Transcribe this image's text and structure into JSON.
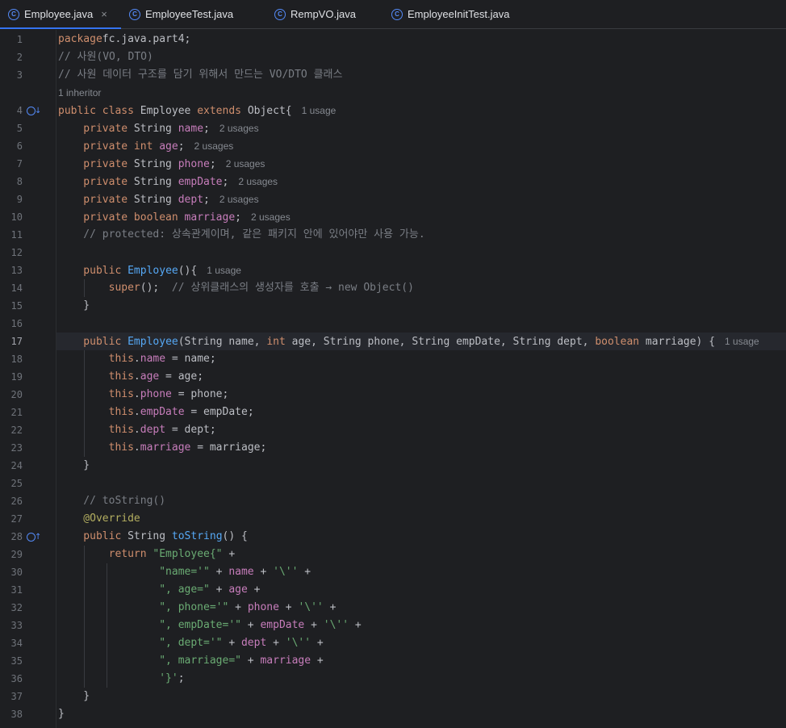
{
  "tabs": [
    {
      "label": "Employee.java",
      "active": true,
      "closable": true
    },
    {
      "label": "EmployeeTest.java",
      "active": false,
      "closable": false
    },
    {
      "label": "RempVO.java",
      "active": false,
      "closable": false
    },
    {
      "label": "EmployeeInitTest.java",
      "active": false,
      "closable": false
    }
  ],
  "tab_close_glyph": "×",
  "inherit_hint": "1 inheritor",
  "current_line": 17,
  "code": {
    "l1": {
      "n": "1",
      "parts": [
        [
          "kw",
          "package"
        ],
        [
          "",
          "fc.java.part4;"
        ]
      ]
    },
    "l2": {
      "n": "2",
      "parts": [
        [
          "cm",
          "// 사원(VO, DTO)"
        ]
      ]
    },
    "l3": {
      "n": "3",
      "parts": [
        [
          "cm",
          "// 사원 데이터 구조를 담기 위해서 만드는 VO/DTO 클래스"
        ]
      ]
    },
    "l4": {
      "n": "4",
      "parts": [
        [
          "kw",
          "public class"
        ],
        [
          "",
          " Employee "
        ],
        [
          "kw",
          "extends"
        ],
        [
          "",
          " Object{"
        ]
      ],
      "hint": "1 usage"
    },
    "l5": {
      "n": "5",
      "parts": [
        [
          "kw",
          "    private"
        ],
        [
          "",
          " String "
        ],
        [
          "fld",
          "name"
        ],
        [
          "",
          ";"
        ]
      ],
      "hint": "2 usages"
    },
    "l6": {
      "n": "6",
      "parts": [
        [
          "kw",
          "    private int"
        ],
        [
          "",
          " "
        ],
        [
          "fld",
          "age"
        ],
        [
          "",
          ";"
        ]
      ],
      "hint": "2 usages"
    },
    "l7": {
      "n": "7",
      "parts": [
        [
          "kw",
          "    private"
        ],
        [
          "",
          " String "
        ],
        [
          "fld",
          "phone"
        ],
        [
          "",
          ";"
        ]
      ],
      "hint": "2 usages"
    },
    "l8": {
      "n": "8",
      "parts": [
        [
          "kw",
          "    private"
        ],
        [
          "",
          " String "
        ],
        [
          "fld",
          "empDate"
        ],
        [
          "",
          ";"
        ]
      ],
      "hint": "2 usages"
    },
    "l9": {
      "n": "9",
      "parts": [
        [
          "kw",
          "    private"
        ],
        [
          "",
          " String "
        ],
        [
          "fld",
          "dept"
        ],
        [
          "",
          ";"
        ]
      ],
      "hint": "2 usages"
    },
    "l10": {
      "n": "10",
      "parts": [
        [
          "kw",
          "    private boolean"
        ],
        [
          "",
          " "
        ],
        [
          "fld",
          "marriage"
        ],
        [
          "",
          ";"
        ]
      ],
      "hint": "2 usages"
    },
    "l11": {
      "n": "11",
      "parts": [
        [
          "cm",
          "    // protected: 상속관계이며, 같은 패키지 안에 있어야만 사용 가능."
        ]
      ]
    },
    "l12": {
      "n": "12",
      "parts": []
    },
    "l13": {
      "n": "13",
      "parts": [
        [
          "kw",
          "    public"
        ],
        [
          "",
          " "
        ],
        [
          "fn",
          "Employee"
        ],
        [
          "",
          "(){"
        ]
      ],
      "hint": "1 usage"
    },
    "l14": {
      "n": "14",
      "parts": [
        [
          "kw",
          "        super"
        ],
        [
          "",
          "();  "
        ],
        [
          "cm",
          "// 상위클래스의 생성자를 호출 → new Object()"
        ]
      ]
    },
    "l15": {
      "n": "15",
      "parts": [
        [
          "",
          "    }"
        ]
      ]
    },
    "l16": {
      "n": "16",
      "parts": []
    },
    "l17": {
      "n": "17",
      "parts": [
        [
          "kw",
          "    public"
        ],
        [
          "",
          " "
        ],
        [
          "fn",
          "Employee"
        ],
        [
          "",
          "(String name, "
        ],
        [
          "kw",
          "int"
        ],
        [
          "",
          " age, String phone, String empDate, String dept, "
        ],
        [
          "kw",
          "boolean"
        ],
        [
          "",
          " marriage) {"
        ]
      ],
      "hint": "1 usage"
    },
    "l18": {
      "n": "18",
      "parts": [
        [
          "kw",
          "        this"
        ],
        [
          "",
          "."
        ],
        [
          "fld",
          "name"
        ],
        [
          "",
          " = name;"
        ]
      ]
    },
    "l19": {
      "n": "19",
      "parts": [
        [
          "kw",
          "        this"
        ],
        [
          "",
          "."
        ],
        [
          "fld",
          "age"
        ],
        [
          "",
          " = age;"
        ]
      ]
    },
    "l20": {
      "n": "20",
      "parts": [
        [
          "kw",
          "        this"
        ],
        [
          "",
          "."
        ],
        [
          "fld",
          "phone"
        ],
        [
          "",
          " = phone;"
        ]
      ]
    },
    "l21": {
      "n": "21",
      "parts": [
        [
          "kw",
          "        this"
        ],
        [
          "",
          "."
        ],
        [
          "fld",
          "empDate"
        ],
        [
          "",
          " = empDate;"
        ]
      ]
    },
    "l22": {
      "n": "22",
      "parts": [
        [
          "kw",
          "        this"
        ],
        [
          "",
          "."
        ],
        [
          "fld",
          "dept"
        ],
        [
          "",
          " = dept;"
        ]
      ]
    },
    "l23": {
      "n": "23",
      "parts": [
        [
          "kw",
          "        this"
        ],
        [
          "",
          "."
        ],
        [
          "fld",
          "marriage"
        ],
        [
          "",
          " = marriage;"
        ]
      ]
    },
    "l24": {
      "n": "24",
      "parts": [
        [
          "",
          "    }"
        ]
      ]
    },
    "l25": {
      "n": "25",
      "parts": []
    },
    "l26": {
      "n": "26",
      "parts": [
        [
          "cm",
          "    // toString()"
        ]
      ]
    },
    "l27": {
      "n": "27",
      "parts": [
        [
          "ann",
          "    @Override"
        ]
      ]
    },
    "l28": {
      "n": "28",
      "parts": [
        [
          "kw",
          "    public"
        ],
        [
          "",
          " String "
        ],
        [
          "fn",
          "toString"
        ],
        [
          "",
          "() {"
        ]
      ]
    },
    "l29": {
      "n": "29",
      "parts": [
        [
          "kw",
          "        return"
        ],
        [
          "",
          " "
        ],
        [
          "str",
          "\"Employee{\""
        ],
        [
          "",
          " +"
        ]
      ]
    },
    "l30": {
      "n": "30",
      "parts": [
        [
          "str",
          "                \"name='\""
        ],
        [
          "",
          " + "
        ],
        [
          "fld",
          "name"
        ],
        [
          "",
          " + "
        ],
        [
          "str",
          "'\\''"
        ],
        [
          "",
          " +"
        ]
      ]
    },
    "l31": {
      "n": "31",
      "parts": [
        [
          "str",
          "                \", age=\""
        ],
        [
          "",
          " + "
        ],
        [
          "fld",
          "age"
        ],
        [
          "",
          " +"
        ]
      ]
    },
    "l32": {
      "n": "32",
      "parts": [
        [
          "str",
          "                \", phone='\""
        ],
        [
          "",
          " + "
        ],
        [
          "fld",
          "phone"
        ],
        [
          "",
          " + "
        ],
        [
          "str",
          "'\\''"
        ],
        [
          "",
          " +"
        ]
      ]
    },
    "l33": {
      "n": "33",
      "parts": [
        [
          "str",
          "                \", empDate='\""
        ],
        [
          "",
          " + "
        ],
        [
          "fld",
          "empDate"
        ],
        [
          "",
          " + "
        ],
        [
          "str",
          "'\\''"
        ],
        [
          "",
          " +"
        ]
      ]
    },
    "l34": {
      "n": "34",
      "parts": [
        [
          "str",
          "                \", dept='\""
        ],
        [
          "",
          " + "
        ],
        [
          "fld",
          "dept"
        ],
        [
          "",
          " + "
        ],
        [
          "str",
          "'\\''"
        ],
        [
          "",
          " +"
        ]
      ]
    },
    "l35": {
      "n": "35",
      "parts": [
        [
          "str",
          "                \", marriage=\""
        ],
        [
          "",
          " + "
        ],
        [
          "fld",
          "marriage"
        ],
        [
          "",
          " +"
        ]
      ]
    },
    "l36": {
      "n": "36",
      "parts": [
        [
          "str",
          "                '}'"
        ],
        [
          "",
          ";"
        ]
      ]
    },
    "l37": {
      "n": "37",
      "parts": [
        [
          "",
          "    }"
        ]
      ]
    },
    "l38": {
      "n": "38",
      "parts": [
        [
          "",
          "}"
        ]
      ]
    }
  },
  "colors": {
    "background": "#1e1f22",
    "keyword": "#cf8e6d",
    "comment": "#7a7e85",
    "field": "#c77dbb",
    "method": "#56a8f5",
    "string": "#6aab73",
    "annotation": "#b3ae60",
    "accent": "#3574f0"
  },
  "gutter_icons": {
    "l4": "implemented-down-icon",
    "l28": "overrides-up-icon"
  }
}
